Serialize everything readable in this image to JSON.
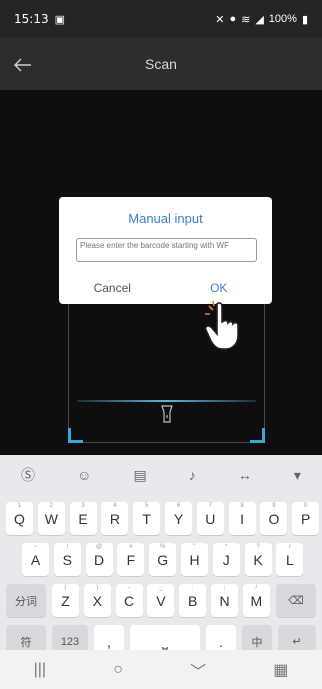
{
  "status_bar": {
    "time": "15:13",
    "battery": "100%"
  },
  "app_bar": {
    "title": "Scan"
  },
  "dialog": {
    "title": "Manual input",
    "placeholder": "Please enter the barcode starting with WF",
    "cancel_label": "Cancel",
    "ok_label": "OK"
  },
  "keyboard": {
    "row1": [
      "Q",
      "W",
      "E",
      "R",
      "T",
      "Y",
      "U",
      "I",
      "O",
      "P"
    ],
    "row1_hints": [
      "1",
      "2",
      "3",
      "4",
      "5",
      "6",
      "7",
      "8",
      "9",
      "0"
    ],
    "row2": [
      "A",
      "S",
      "D",
      "F",
      "G",
      "H",
      "J",
      "K",
      "L"
    ],
    "row2_hints": [
      "~",
      "!",
      "@",
      "#",
      "%",
      "\"",
      "*",
      "?",
      "/"
    ],
    "row3": [
      "Z",
      "X",
      "C",
      "V",
      "B",
      "N",
      "M"
    ],
    "row3_hints": [
      "(",
      ")",
      "-",
      "_",
      ":",
      ";",
      "/"
    ],
    "row4": {
      "symbols": "符",
      "numbers": "123",
      "comma": ",",
      "period": ".",
      "cn_en": "中"
    },
    "row3_left": "分词"
  },
  "colors": {
    "accent": "#3d7fc8",
    "scan_corner": "#3aa5d8"
  }
}
